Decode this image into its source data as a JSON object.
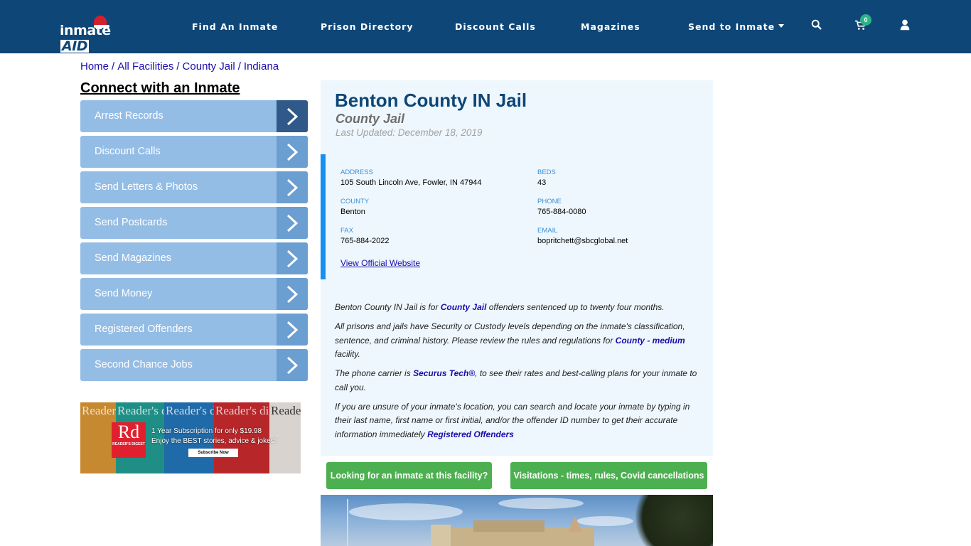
{
  "header": {
    "logo": {
      "text_left": "inmate",
      "text_right": "AID"
    },
    "nav": [
      {
        "label": "Find An Inmate"
      },
      {
        "label": "Prison Directory"
      },
      {
        "label": "Discount Calls"
      },
      {
        "label": "Magazines"
      },
      {
        "label": "Send to Inmate",
        "has_dropdown": true
      }
    ],
    "icons": {
      "search": "search-icon",
      "cart": "shopping-cart-icon",
      "cart_count": "0",
      "user": "user-icon"
    }
  },
  "breadcrumb": [
    {
      "label": "Home"
    },
    {
      "label": "All Facilities"
    },
    {
      "label": "County Jail"
    },
    {
      "label": "Indiana"
    }
  ],
  "breadcrumb_separator": "/",
  "sidebar": {
    "title": "Connect with an Inmate",
    "items": [
      {
        "label": "Arrest Records"
      },
      {
        "label": "Discount Calls"
      },
      {
        "label": "Send Letters & Photos"
      },
      {
        "label": "Send Postcards"
      },
      {
        "label": "Send Magazines"
      },
      {
        "label": "Send Money"
      },
      {
        "label": "Registered Offenders"
      },
      {
        "label": "Second Chance Jobs"
      }
    ],
    "ad": {
      "masthead": "Reader's digest",
      "logo_big": "Rd",
      "logo_small": "READER'S DIGEST",
      "line1": "1 Year Subscription for only $19.98",
      "line2": "Enjoy the BEST stories, advice & jokes!",
      "button": "Subscribe Now"
    }
  },
  "facility": {
    "name": "Benton County IN Jail",
    "type": "County Jail",
    "last_updated": "Last Updated: December 18, 2019",
    "info": {
      "address_label": "ADDRESS",
      "address": "105 South Lincoln Ave, Fowler, IN 47944",
      "beds_label": "BEDS",
      "beds": "43",
      "county_label": "COUNTY",
      "county": "Benton",
      "phone_label": "PHONE",
      "phone": "765-884-0080",
      "fax_label": "FAX",
      "fax": "765-884-2022",
      "email_label": "EMAIL",
      "email": "bopritchett@sbcglobal.net",
      "website_link": "View Official Website"
    },
    "description": {
      "p1_before": "Benton County IN Jail is for ",
      "p1_link": "County Jail",
      "p1_after": " offenders sentenced up to twenty four months.",
      "p2_before": "All prisons and jails have Security or Custody levels depending on the inmate's classification, sentence, and criminal history. Please review the rules and regulations for ",
      "p2_link": "County - medium",
      "p2_after": " facility.",
      "p3_before": "The phone carrier is ",
      "p3_link": "Securus Tech®",
      "p3_after": ", to see their rates and best-calling plans for your inmate to call you.",
      "p4_before": "If you are unsure of your inmate's location, you can search and locate your inmate by typing in their last name, first name or first initial, and/or the offender ID number to get their accurate information immediately ",
      "p4_link": "Registered Offenders"
    },
    "buttons": {
      "find_inmate": "Looking for an inmate at this facility?",
      "visitations": "Visitations - times, rules, Covid cancellations"
    }
  },
  "colors": {
    "navbar": "#0e4677",
    "sidebar_item": "#94bde6",
    "sidebar_arrow": "#6b9ed1",
    "sidebar_arrow_active": "#2f5988",
    "card_bg": "#eef7fd",
    "info_accent": "#1590f0",
    "green_button": "#4caf50",
    "link": "#1a0dab"
  }
}
